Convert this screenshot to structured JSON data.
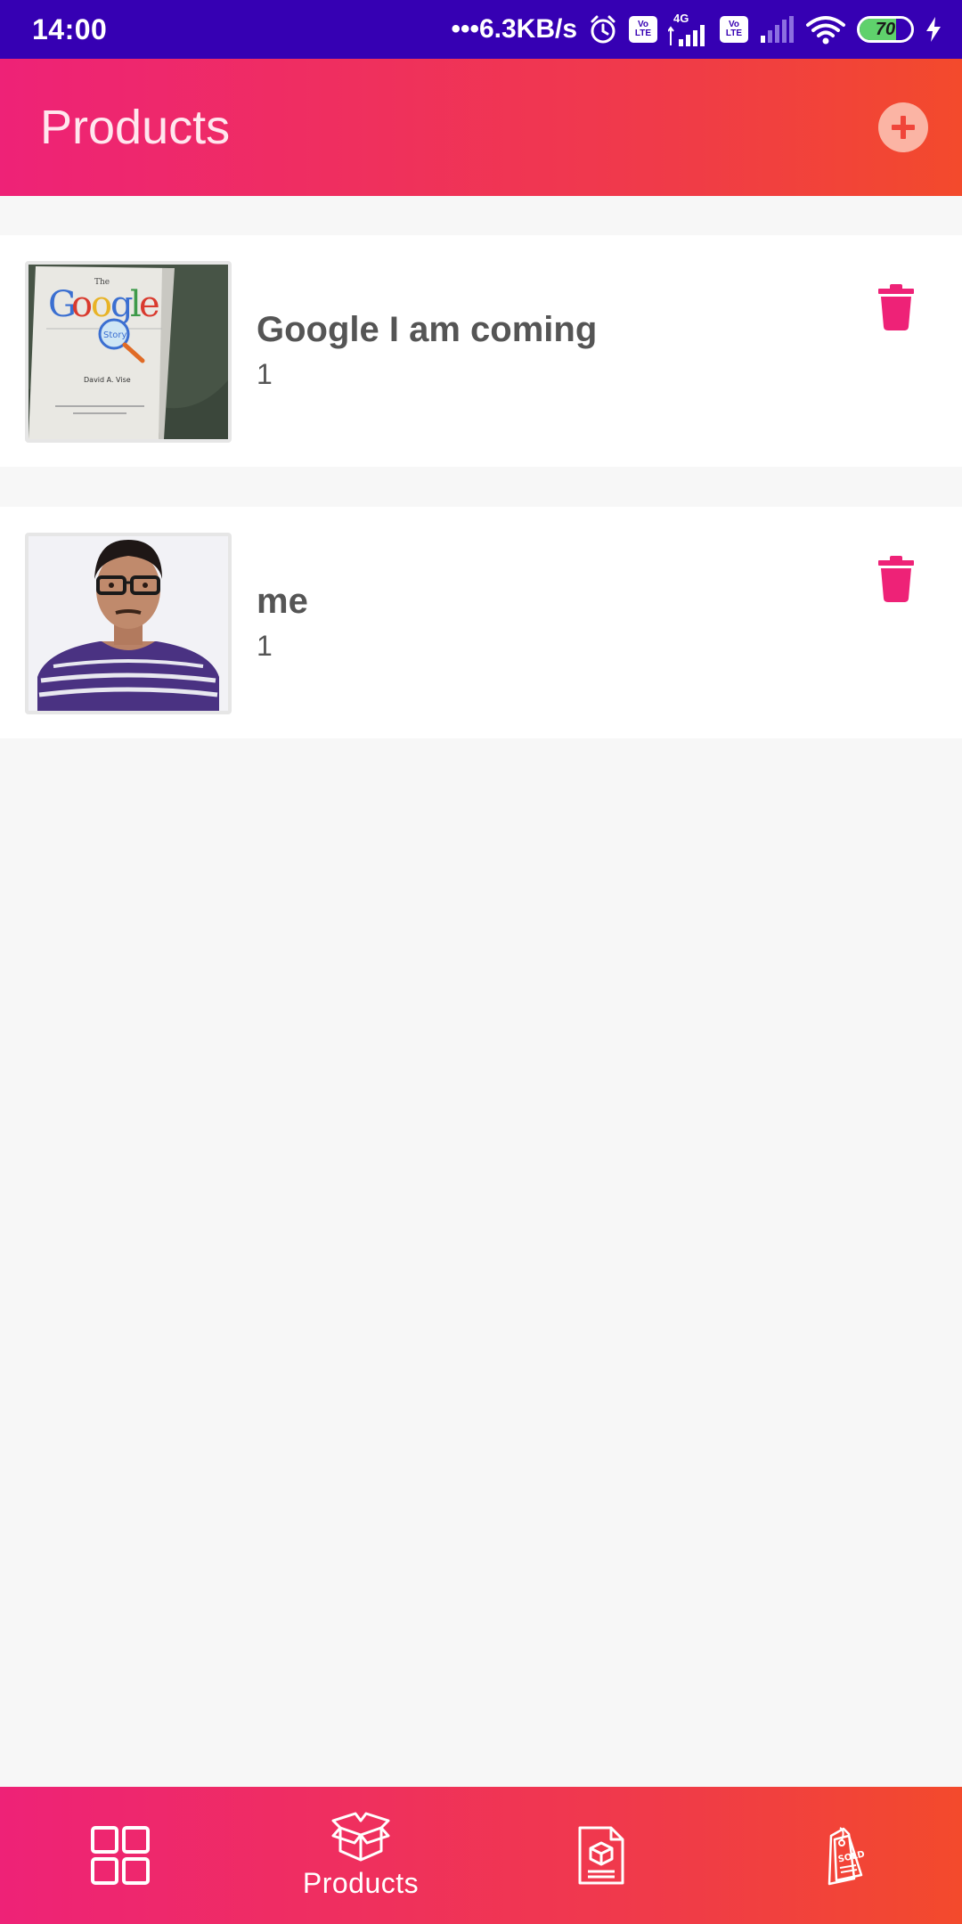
{
  "status_bar": {
    "time": "14:00",
    "net_speed": "•••6.3KB/s",
    "network_type": "4G",
    "volte_label": "Vo LTE",
    "battery_level": "70",
    "battery_fraction": 0.7,
    "icons": [
      "alarm-icon",
      "volte-icon",
      "signal-icon",
      "volte-icon",
      "signal-weak-icon",
      "wifi-icon",
      "battery-icon",
      "charging-icon"
    ]
  },
  "app_bar": {
    "title": "Products",
    "add_icon": "plus-circle-icon"
  },
  "products": [
    {
      "name": "Google I am coming",
      "quantity": "1",
      "image": "book-cover-photo"
    },
    {
      "name": "me",
      "quantity": "1",
      "image": "portrait-photo"
    }
  ],
  "bottom_nav": {
    "items": [
      {
        "icon": "dashboard-grid-icon",
        "label": ""
      },
      {
        "icon": "box-icon",
        "label": "Products"
      },
      {
        "icon": "document-box-icon",
        "label": ""
      },
      {
        "icon": "sold-tag-icon",
        "label": ""
      }
    ]
  },
  "colors": {
    "status_bar": "#3600b3",
    "accent_start": "#ee2277",
    "accent_end": "#f34a2c",
    "delete_icon": "#ee2277",
    "background": "#f7f7f7"
  }
}
